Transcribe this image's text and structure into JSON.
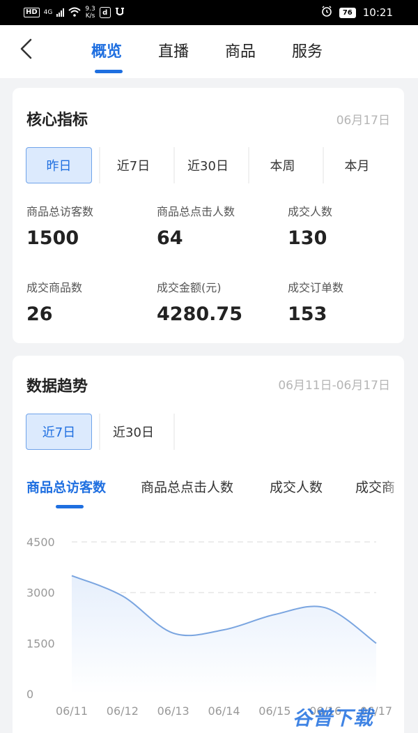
{
  "status_bar": {
    "hd": "HD",
    "network": "4G",
    "speed_top": "9.3",
    "speed_bottom": "K/s",
    "app_icon": "d",
    "battery": "76",
    "time": "10:21",
    "icons": [
      "signal-icon",
      "wifi-icon",
      "alarm-icon",
      "battery-icon"
    ]
  },
  "nav": {
    "back_icon": "chevron-left-icon",
    "tabs": [
      {
        "label": "概览",
        "active": true
      },
      {
        "label": "直播",
        "active": false
      },
      {
        "label": "商品",
        "active": false
      },
      {
        "label": "服务",
        "active": false
      }
    ]
  },
  "core": {
    "title": "核心指标",
    "date": "06月17日",
    "ranges": [
      {
        "label": "昨日",
        "selected": true
      },
      {
        "label": "近7日",
        "selected": false
      },
      {
        "label": "近30日",
        "selected": false
      },
      {
        "label": "本周",
        "selected": false
      },
      {
        "label": "本月",
        "selected": false
      }
    ],
    "metrics": [
      {
        "label": "商品总访客数",
        "value": "1500"
      },
      {
        "label": "商品总点击人数",
        "value": "64"
      },
      {
        "label": "成交人数",
        "value": "130"
      },
      {
        "label": "成交商品数",
        "value": "26"
      },
      {
        "label": "成交金额(元)",
        "value": "4280.75"
      },
      {
        "label": "成交订单数",
        "value": "153"
      }
    ]
  },
  "trend": {
    "title": "数据趋势",
    "date_range": "06月11日-06月17日",
    "ranges": [
      {
        "label": "近7日",
        "selected": true
      },
      {
        "label": "近30日",
        "selected": false
      }
    ],
    "metric_tabs": [
      {
        "label": "商品总访客数",
        "active": true
      },
      {
        "label": "商品总点击人数",
        "active": false
      },
      {
        "label": "成交人数",
        "active": false
      },
      {
        "label": "成交商",
        "active": false
      }
    ]
  },
  "chart_data": {
    "type": "area",
    "title": "",
    "xlabel": "",
    "ylabel": "",
    "x": [
      "06/11",
      "06/12",
      "06/13",
      "06/14",
      "06/15",
      "06/16",
      "06/17"
    ],
    "series": [
      {
        "values": [
          3500,
          2900,
          1800,
          1900,
          2350,
          2550,
          1500
        ]
      }
    ],
    "y_ticks": [
      0,
      1500,
      3000,
      4500
    ],
    "ylim": [
      0,
      4500
    ],
    "grid": true,
    "line_color": "#7aa5e0",
    "fill_color": "#e6effc"
  },
  "watermark": "谷普下载",
  "colors": {
    "accent": "#1f6fe0",
    "selected_bg": "#dceafd"
  }
}
